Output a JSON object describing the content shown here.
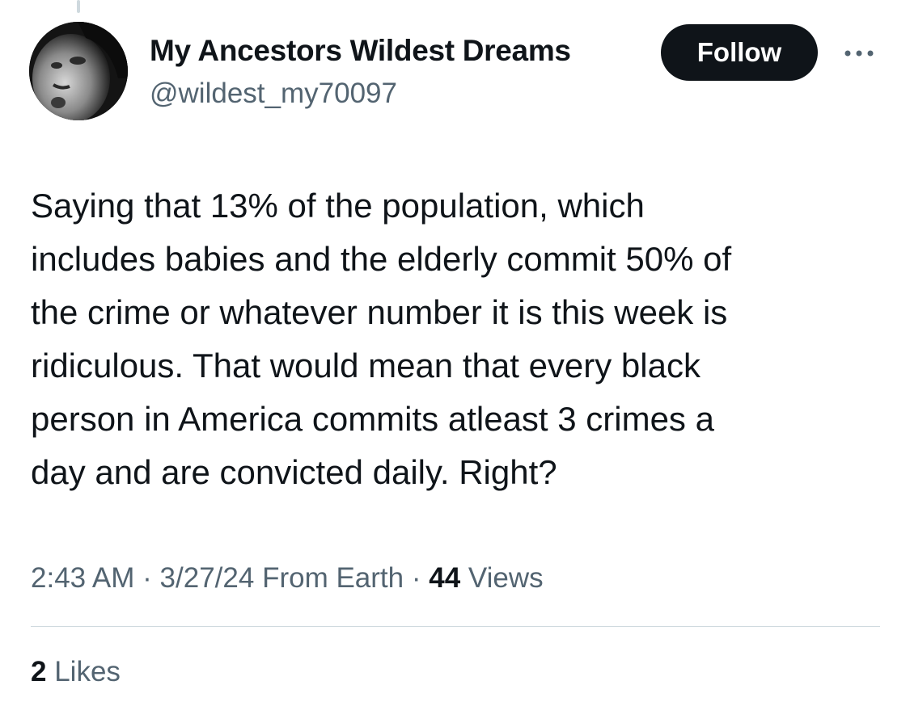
{
  "author": {
    "display_name": "My Ancestors Wildest Dreams",
    "handle": "@wildest_my70097",
    "avatar_icon": "avatar-image"
  },
  "follow_button": {
    "label": "Follow"
  },
  "more_menu": {
    "icon": "more-options-icon"
  },
  "tweet": {
    "lines": [
      "Saying that 13% of the population, which",
      "includes babies and the elderly commit 50% of",
      "the crime or whatever number it is this week is",
      "ridiculous. That would mean that every black",
      "person in America commits atleast 3 crimes a",
      "day and are convicted daily. Right?"
    ]
  },
  "meta": {
    "time": "2:43 AM",
    "date": "3/27/24",
    "source": "From Earth",
    "separator": "·",
    "views_count": "44",
    "views_label": "Views"
  },
  "engagement": {
    "likes_count": "2",
    "likes_label": "Likes"
  },
  "colors": {
    "text_primary": "#0f1419",
    "text_secondary": "#536471",
    "divider": "#cfd9de",
    "button_bg": "#0f1419",
    "button_text": "#ffffff"
  }
}
